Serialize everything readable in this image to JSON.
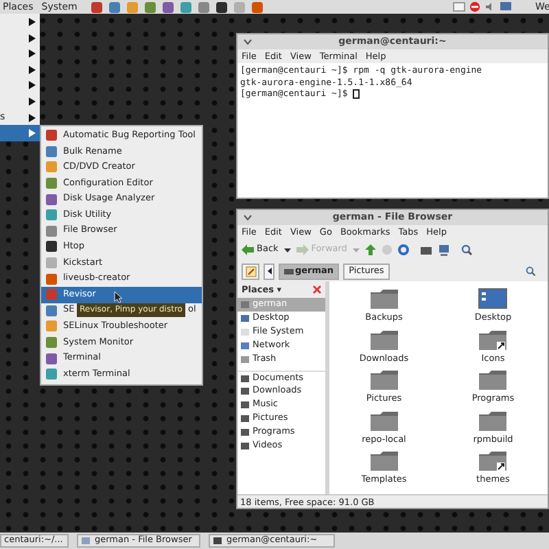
{
  "top_panel": {
    "menus": [
      "Places",
      "System"
    ],
    "clock_fragment": "We"
  },
  "main_menu": {
    "items": [
      {
        "selected": false
      },
      {
        "selected": false
      },
      {
        "selected": false
      },
      {
        "selected": false
      },
      {
        "selected": false
      },
      {
        "selected": false
      },
      {
        "label": "s",
        "selected": false
      },
      {
        "selected": true
      }
    ]
  },
  "submenu": {
    "items": [
      {
        "label": "Automatic Bug Reporting Tool",
        "selected": false
      },
      {
        "label": "Bulk Rename",
        "selected": false
      },
      {
        "label": "CD/DVD Creator",
        "selected": false
      },
      {
        "label": "Configuration Editor",
        "selected": false
      },
      {
        "label": "Disk Usage Analyzer",
        "selected": false
      },
      {
        "label": "Disk Utility",
        "selected": false
      },
      {
        "label": "File Browser",
        "selected": false
      },
      {
        "label": "Htop",
        "selected": false
      },
      {
        "label": "Kickstart",
        "selected": false
      },
      {
        "label": "liveusb-creator",
        "selected": false
      },
      {
        "label": "Revisor",
        "selected": true
      },
      {
        "label": "SE",
        "label_tail": "ol",
        "selected": false
      },
      {
        "label": "SELinux Troubleshooter",
        "selected": false
      },
      {
        "label": "System Monitor",
        "selected": false
      },
      {
        "label": "Terminal",
        "selected": false
      },
      {
        "label": "xterm Terminal",
        "selected": false
      }
    ],
    "tooltip": "Revisor, Pimp your distro"
  },
  "terminal": {
    "title": "german@centauri:~",
    "menu": [
      "File",
      "Edit",
      "View",
      "Terminal",
      "Help"
    ],
    "lines": [
      "[german@centauri ~]$ rpm -q gtk-aurora-engine",
      "gtk-aurora-engine-1.5.1-1.x86_64",
      "[german@centauri ~]$ "
    ]
  },
  "file_browser": {
    "title": "german - File Browser",
    "menu": [
      "File",
      "Edit",
      "View",
      "Go",
      "Bookmarks",
      "Tabs",
      "Help"
    ],
    "toolbar": [
      {
        "kind": "back",
        "label": "Back",
        "disabled": false
      },
      {
        "kind": "forward",
        "label": "Forward",
        "disabled": true
      }
    ],
    "path": [
      {
        "label": "german",
        "selected": true
      },
      {
        "label": "Pictures",
        "selected": false
      }
    ],
    "sidebar": {
      "header": "Places ▾",
      "items": [
        {
          "label": "german",
          "selected": true
        },
        {
          "label": "Desktop",
          "selected": false
        },
        {
          "label": "File System",
          "selected": false
        },
        {
          "label": "Network",
          "selected": false
        },
        {
          "label": "Trash",
          "selected": false
        },
        {
          "label": "Documents",
          "selected": false
        },
        {
          "label": "Downloads",
          "selected": false
        },
        {
          "label": "Music",
          "selected": false
        },
        {
          "label": "Pictures",
          "selected": false
        },
        {
          "label": "Programs",
          "selected": false
        },
        {
          "label": "Videos",
          "selected": false
        }
      ]
    },
    "files": [
      {
        "name": "Backups",
        "kind": "folder",
        "link": false
      },
      {
        "name": "Desktop",
        "kind": "desktop",
        "link": false
      },
      {
        "name": "Downloads",
        "kind": "folder",
        "link": false
      },
      {
        "name": "Icons",
        "kind": "folder",
        "link": true
      },
      {
        "name": "Pictures",
        "kind": "folder",
        "link": false
      },
      {
        "name": "Programs",
        "kind": "folder",
        "link": false
      },
      {
        "name": "repo-local",
        "kind": "folder",
        "link": false
      },
      {
        "name": "rpmbuild",
        "kind": "folder",
        "link": false
      },
      {
        "name": "Templates",
        "kind": "folder",
        "link": false
      },
      {
        "name": "themes",
        "kind": "folder",
        "link": true
      }
    ],
    "status": "18 items, Free space: 91.0 GB"
  },
  "taskbar": [
    {
      "label": "centauri:~/..."
    },
    {
      "label": "german - File Browser"
    },
    {
      "label": "german@centauri:~"
    }
  ]
}
